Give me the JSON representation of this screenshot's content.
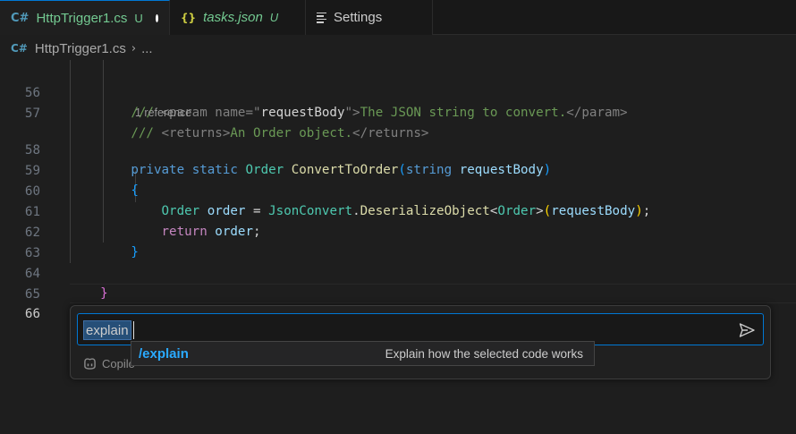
{
  "tabs": [
    {
      "icon": "csharp-file-icon",
      "label": "HttpTrigger1.cs",
      "status": "U",
      "active": true,
      "dirty": true
    },
    {
      "icon": "json-file-icon",
      "label": "tasks.json",
      "status": "U",
      "active": false
    },
    {
      "icon": "settings-icon",
      "label": "Settings",
      "active": false
    }
  ],
  "breadcrumb": {
    "file": "HttpTrigger1.cs",
    "more": "..."
  },
  "editor": {
    "codelens": "1 reference",
    "lines": [
      {
        "number": "56",
        "text": "        /// <param name=\"requestBody\">The JSON string to convert.</param>"
      },
      {
        "number": "57",
        "text": "        /// <returns>An Order object.</returns>"
      },
      {
        "number": "58",
        "text": "        private static Order ConvertToOrder(string requestBody)"
      },
      {
        "number": "59",
        "text": "        {"
      },
      {
        "number": "60",
        "text": "            Order order = JsonConvert.DeserializeObject<Order>(requestBody);"
      },
      {
        "number": "61",
        "text": "            return order;"
      },
      {
        "number": "62",
        "text": "        }"
      },
      {
        "number": "63",
        "text": ""
      },
      {
        "number": "64",
        "text": "    }"
      },
      {
        "number": "65",
        "text": "}"
      },
      {
        "number": "66",
        "text": ""
      }
    ],
    "current_line": "66"
  },
  "inline_chat": {
    "input_value": "explain",
    "send_icon": "send-icon",
    "footer_icon": "copilot-icon",
    "footer_text": "Copilo"
  },
  "suggestion": {
    "command": "/explain",
    "description": "Explain how the selected code works"
  },
  "colors": {
    "accent": "#0078d4",
    "untracked": "#73c991",
    "command": "#2aaaff"
  }
}
